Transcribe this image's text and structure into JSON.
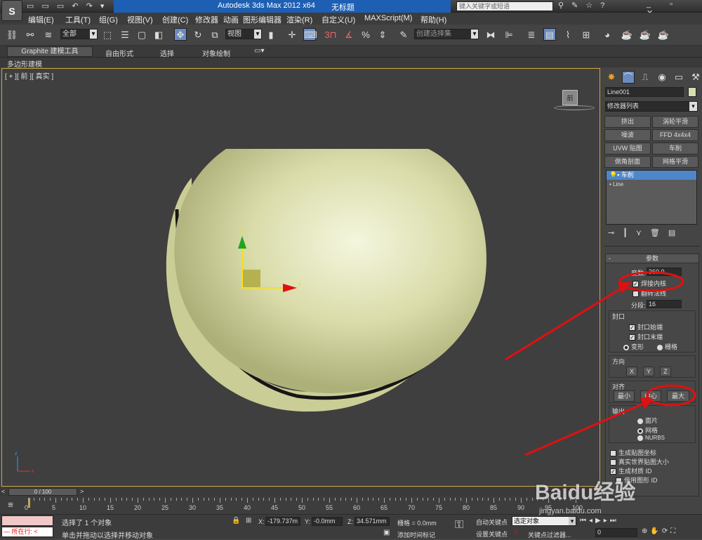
{
  "window": {
    "title": "Autodesk 3ds Max  2012 x64",
    "file": "无标题",
    "search_placeholder": "键入关键字或短语"
  },
  "menu": [
    "编辑(E)",
    "工具(T)",
    "组(G)",
    "视图(V)",
    "创建(C)",
    "修改器",
    "动画",
    "图形编辑器",
    "渲染(R)",
    "自定义(U)",
    "MAXScript(M)",
    "帮助(H)"
  ],
  "toolbar": {
    "selection_filter": "全部",
    "ref_coord": "视图",
    "named_selection": "创建选择集"
  },
  "ribbon": {
    "tabs": [
      "Graphite 建模工具",
      "自由形式",
      "选择",
      "对象绘制"
    ],
    "sub": "多边形建模"
  },
  "viewport": {
    "label": "[ + ][ 前 ][ 真实 ]",
    "viewcube": "前"
  },
  "command_panel": {
    "object_name": "Line001",
    "modifier_list": "修改器列表",
    "mod_buttons": [
      "挤出",
      "涡轮平滑",
      "噪波",
      "FFD 4x4x4",
      "UVW 贴图",
      "车削",
      "倒角剖面",
      "网格平滑"
    ],
    "stack": [
      "车削",
      "Line"
    ],
    "params": {
      "title": "参数",
      "degrees_label": "度数:",
      "degrees_value": "360.0",
      "weld_core": "焊接内核",
      "flip_normals": "翻转法线",
      "segments_label": "分段:",
      "segments_value": "16",
      "capping_title": "封口",
      "cap_start": "封口始端",
      "cap_end": "封口末端",
      "morph": "变形",
      "grid": "栅格",
      "direction_title": "方向",
      "dir": [
        "X",
        "Y",
        "Z"
      ],
      "align_title": "对齐",
      "align": [
        "最小",
        "中心",
        "最大"
      ],
      "output_title": "输出",
      "out": [
        "面片",
        "网格",
        "NURBS"
      ],
      "gen_map": "生成贴图坐标",
      "real_world": "真实世界贴图大小",
      "gen_mat": "生成材质 ID",
      "use_shape": "使用图形 ID"
    }
  },
  "timeslider": {
    "frame": "0 / 100"
  },
  "trackbar": {
    "ticks": [
      "0",
      "5",
      "10",
      "15",
      "20",
      "25",
      "30",
      "35",
      "40",
      "45",
      "50",
      "55",
      "60",
      "65",
      "70",
      "75",
      "80",
      "85",
      "90",
      "95",
      "100"
    ]
  },
  "status": {
    "selected": "选择了 1 个对象",
    "prompt": "单击并拖动以选择并移动对象",
    "running": "所在行:",
    "x_label": "X:",
    "x": "-179.737m",
    "y_label": "Y:",
    "y": "-0.0mm",
    "z_label": "Z:",
    "z": "34.571mm",
    "grid": "栅格 = 0.0mm",
    "add_time_tag": "添加时间标记",
    "auto_key": "自动关键点",
    "set_key": "设置关键点",
    "selected_obj": "选定对象",
    "key_filters": "关键点过滤器...",
    "frame": "0"
  },
  "watermark": {
    "brand": "Baidu经验",
    "url": "jingyan.baidu.com"
  },
  "colors": {
    "viewport_bg": "#3f3f3f",
    "object": "#d8dcb0",
    "annotation": "#e01010",
    "active_border": "#c9a640"
  }
}
